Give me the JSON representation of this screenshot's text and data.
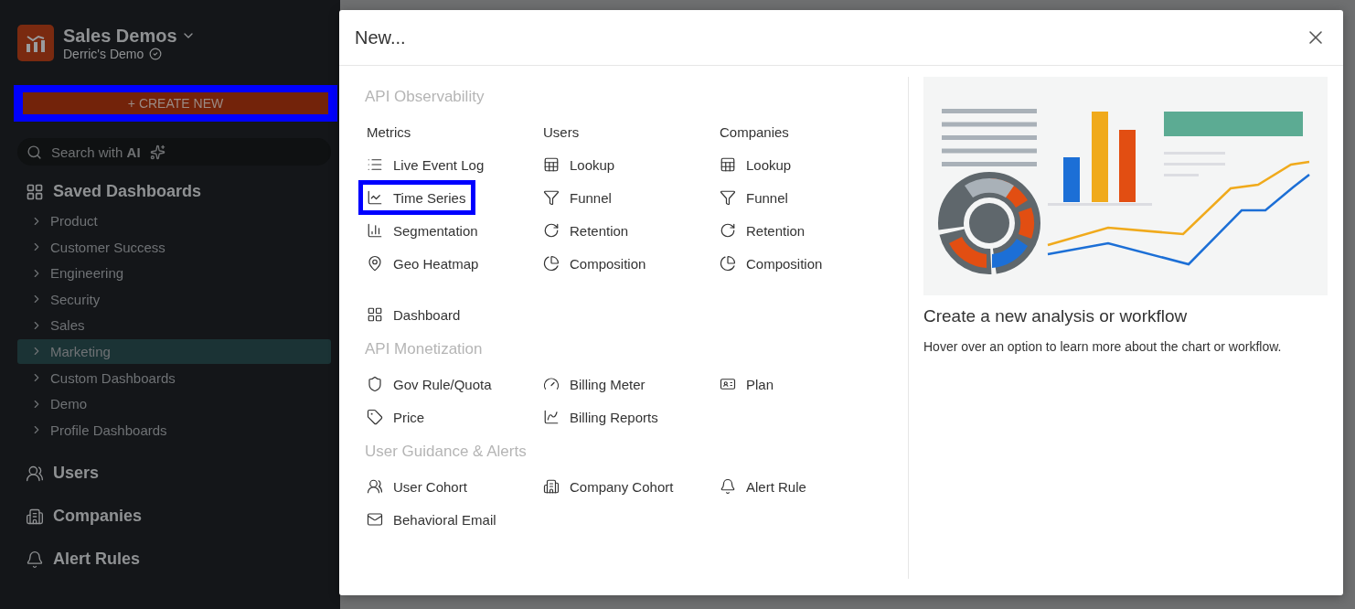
{
  "sidebar": {
    "workspace": {
      "name": "Sales Demos",
      "subtitle": "Derric's Demo"
    },
    "create_button": {
      "label": "+ CREATE NEW",
      "highlighted": true
    },
    "search": {
      "text": "Search with **AI**"
    },
    "saved_dashboards": {
      "title": "Saved Dashboards",
      "items": [
        {
          "label": "Product",
          "selected": false
        },
        {
          "label": "Customer Success",
          "selected": false
        },
        {
          "label": "Engineering",
          "selected": false
        },
        {
          "label": "Security",
          "selected": false
        },
        {
          "label": "Sales",
          "selected": false
        },
        {
          "label": "Marketing",
          "selected": true
        },
        {
          "label": "Custom Dashboards",
          "selected": false
        },
        {
          "label": "Demo",
          "selected": false
        },
        {
          "label": "Profile Dashboards",
          "selected": false
        }
      ]
    },
    "nav": [
      {
        "label": "Users"
      },
      {
        "label": "Companies"
      },
      {
        "label": "Alert Rules"
      }
    ]
  },
  "modal": {
    "title": "New...",
    "sections": [
      {
        "title": "API Observability",
        "headings": [
          "Metrics",
          "Users",
          "Companies"
        ],
        "rows": [
          [
            {
              "label": "Live Event Log",
              "highlighted": false
            },
            {
              "label": "Lookup",
              "highlighted": false
            },
            {
              "label": "Lookup",
              "highlighted": false
            }
          ],
          [
            {
              "label": "Time Series",
              "highlighted": true
            },
            {
              "label": "Funnel",
              "highlighted": false
            },
            {
              "label": "Funnel",
              "highlighted": false
            }
          ],
          [
            {
              "label": "Segmentation",
              "highlighted": false
            },
            {
              "label": "Retention",
              "highlighted": false
            },
            {
              "label": "Retention",
              "highlighted": false
            }
          ],
          [
            {
              "label": "Geo Heatmap",
              "highlighted": false
            },
            {
              "label": "Composition",
              "highlighted": false
            },
            {
              "label": "Composition",
              "highlighted": false
            }
          ]
        ]
      },
      {
        "rows": [
          [
            {
              "label": "Dashboard",
              "highlighted": false
            }
          ]
        ]
      },
      {
        "title": "API Monetization",
        "rows": [
          [
            {
              "label": "Gov Rule/Quota",
              "highlighted": false
            },
            {
              "label": "Billing Meter",
              "highlighted": false
            },
            {
              "label": "Plan",
              "highlighted": false
            }
          ],
          [
            {
              "label": "Price",
              "highlighted": false
            },
            {
              "label": "Billing Reports",
              "highlighted": false
            }
          ]
        ]
      },
      {
        "title": "User Guidance & Alerts",
        "rows": [
          [
            {
              "label": "User Cohort",
              "highlighted": false
            },
            {
              "label": "Company Cohort",
              "highlighted": false
            },
            {
              "label": "Alert Rule",
              "highlighted": false
            }
          ],
          [
            {
              "label": "Behavioral Email",
              "highlighted": false
            }
          ]
        ]
      }
    ],
    "preview": {
      "title": "Create a new analysis or workflow",
      "description": "Hover over an option to learn more about the chart or workflow."
    }
  }
}
